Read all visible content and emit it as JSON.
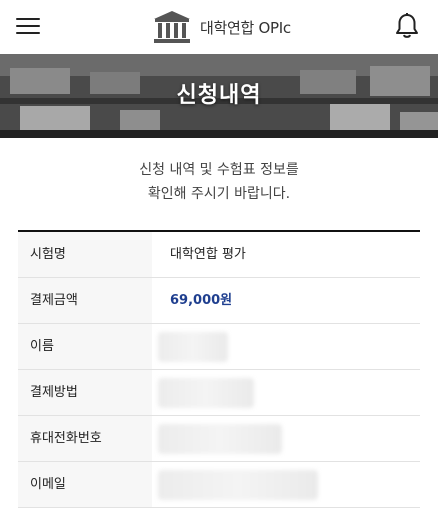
{
  "header": {
    "menu_icon": "hamburger-menu-icon",
    "logo_icon": "building-pillars-icon",
    "logo_text": "대학연합 OPIc",
    "bell_icon": "bell-icon"
  },
  "hero": {
    "title": "신청내역"
  },
  "notice": {
    "line1": "신청 내역 및 수험표 정보를",
    "line2": "확인해 주시기 바랍니다."
  },
  "details": {
    "rows": [
      {
        "label": "시험명",
        "value": "대학연합 평가"
      },
      {
        "label": "결제금액",
        "value": "69,000원"
      },
      {
        "label": "이름",
        "value": ""
      },
      {
        "label": "결제방법",
        "value": ""
      },
      {
        "label": "휴대전화번호",
        "value": ""
      },
      {
        "label": "이메일",
        "value": ""
      }
    ]
  },
  "colors": {
    "price": "#1f3f8f",
    "table_border": "#111111",
    "label_bg": "#f7f7f7"
  }
}
